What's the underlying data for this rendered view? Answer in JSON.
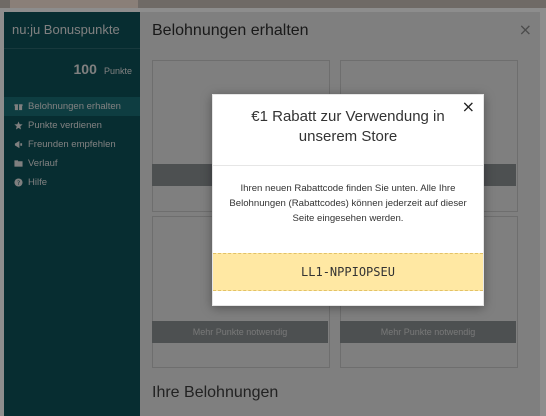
{
  "app": {
    "brand": "nu:ju Bonuspunkte",
    "points_value": "100",
    "points_unit": "Punkte"
  },
  "nav": [
    {
      "label": "Belohnungen erhalten",
      "icon": "gift-icon",
      "active": true
    },
    {
      "label": "Punkte verdienen",
      "icon": "star-icon",
      "active": false
    },
    {
      "label": "Freunden empfehlen",
      "icon": "megaphone-icon",
      "active": false
    },
    {
      "label": "Verlauf",
      "icon": "folder-icon",
      "active": false
    },
    {
      "label": "Hilfe",
      "icon": "question-circle-icon",
      "active": false
    }
  ],
  "main": {
    "title": "Belohnungen erhalten",
    "close_label": "×",
    "cta_label": "Mehr Punkte notwendig",
    "section_title": "Ihre Belohnungen"
  },
  "modal": {
    "close_label": "×",
    "title": "€1 Rabatt zur Verwendung in unserem Store",
    "body": "Ihren neuen Rabattcode finden Sie unten. Alle Ihre Belohnungen (Rabattcodes) können jederzeit auf dieser Seite eingesehen werden.",
    "code": "LL1-NPPIOPSEU"
  },
  "colors": {
    "sidebar": "#0e5b63",
    "sidebar_active": "#1d7a83",
    "code_bg": "#ffe8a3"
  }
}
